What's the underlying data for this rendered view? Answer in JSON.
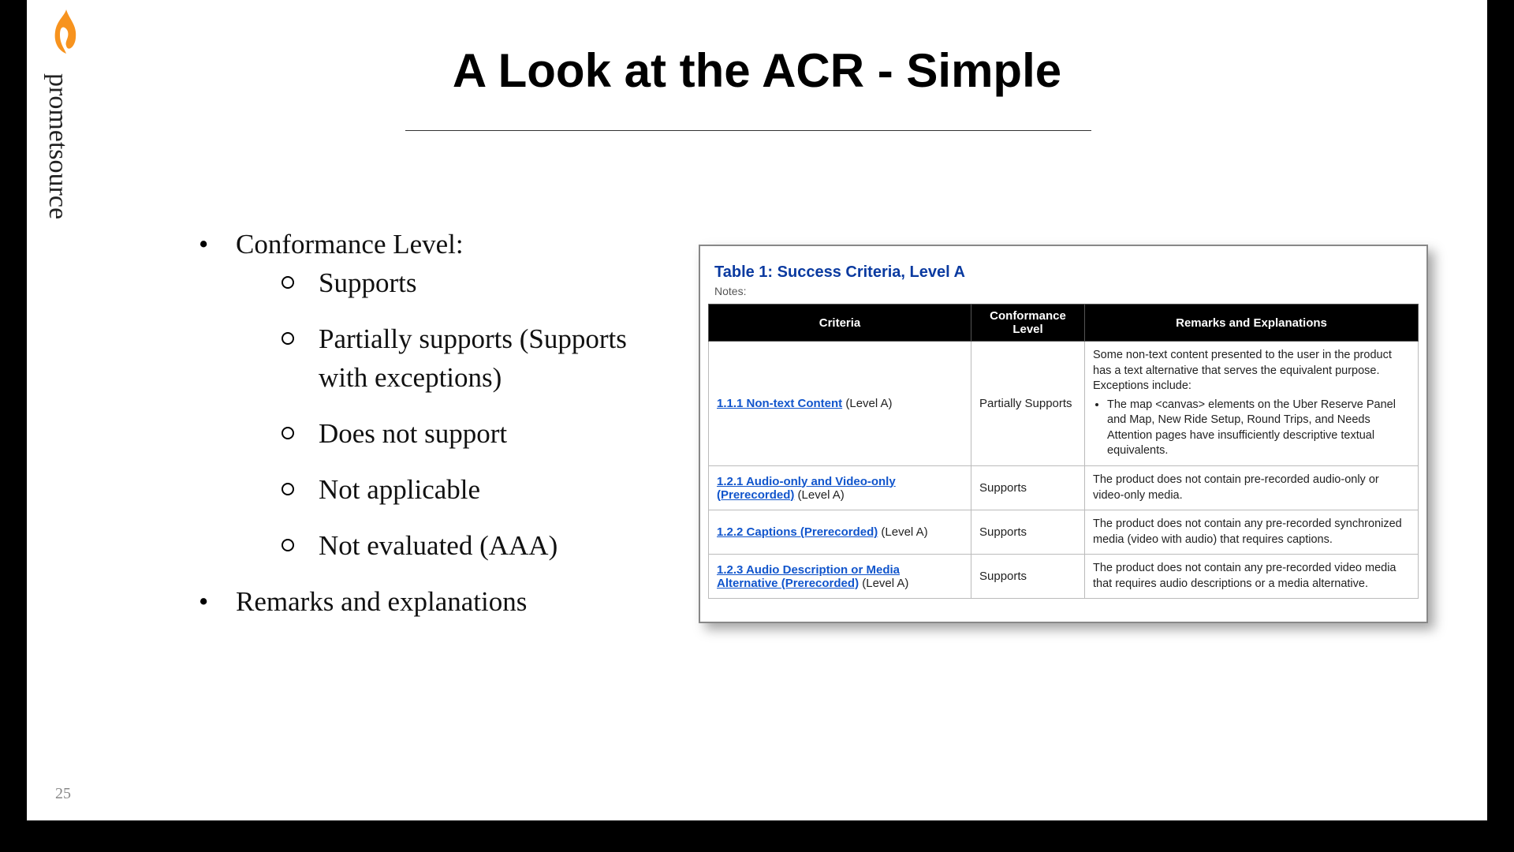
{
  "brand": {
    "name": "prometsource"
  },
  "slide": {
    "title": "A Look at the ACR - Simple",
    "number": "25",
    "left_column": {
      "heading_1": "Conformance Level:",
      "sub_items": [
        "Supports",
        "Partially supports (Supports with exceptions)",
        "Does not support",
        "Not applicable",
        "Not evaluated (AAA)"
      ],
      "heading_2": "Remarks and explanations"
    },
    "table_card": {
      "title": "Table 1: Success Criteria, Level A",
      "notes_label": "Notes:",
      "headers": {
        "criteria": "Criteria",
        "level": "Conformance Level",
        "remarks": "Remarks and Explanations"
      },
      "rows": [
        {
          "link": "1.1.1 Non-text Content",
          "suffix": " (Level A)",
          "level": "Partially Supports",
          "remarks_intro": "Some non-text content presented to the user in the product has a text alternative that serves the equivalent purpose. Exceptions include:",
          "remarks_bullets": [
            "The map <canvas> elements on the Uber Reserve Panel and Map, New Ride Setup, Round Trips, and Needs Attention pages have insufficiently descriptive textual equivalents."
          ]
        },
        {
          "link": "1.2.1 Audio-only and Video-only (Prerecorded)",
          "suffix": " (Level A)",
          "level": "Supports",
          "remarks": "The product does not contain pre-recorded audio-only or video-only media."
        },
        {
          "link": "1.2.2 Captions (Prerecorded)",
          "suffix": " (Level A)",
          "level": "Supports",
          "remarks": "The product does not contain any pre-recorded synchronized media (video with audio) that requires captions."
        },
        {
          "link": "1.2.3 Audio Description or Media Alternative (Prerecorded)",
          "suffix": " (Level A)",
          "level": "Supports",
          "remarks": "The product does not contain any pre-recorded video media that requires audio descriptions or a media alternative."
        }
      ]
    }
  }
}
